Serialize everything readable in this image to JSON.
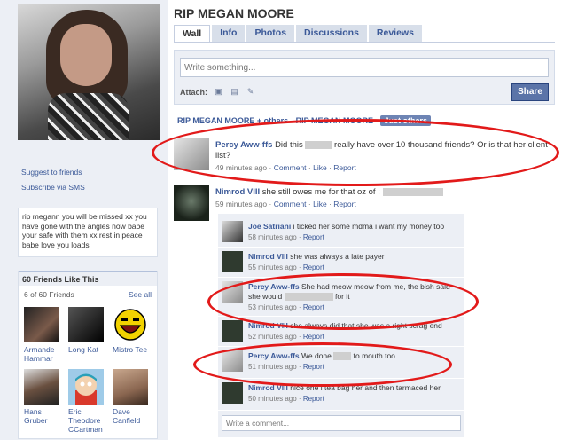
{
  "page": {
    "title": "RIP MEGAN MOORE"
  },
  "tabs": [
    "Wall",
    "Info",
    "Photos",
    "Discussions",
    "Reviews"
  ],
  "sidebar": {
    "links": [
      "Suggest to friends",
      "Subscribe via SMS"
    ],
    "bio": "rip megann you will be missed xx you have gone with the angles now babe your safe with them xx rest in peace babe love you loads",
    "friends_title": "60 Friends Like This",
    "friends_count": "6 of 60 Friends",
    "see_all": "See all",
    "friends": [
      {
        "name": "Armande Hammar"
      },
      {
        "name": "Long Kat"
      },
      {
        "name": "Mistro Tee"
      },
      {
        "name": "Hans Gruber"
      },
      {
        "name": "Eric Theodore CCartman"
      },
      {
        "name": "Dave Canfield"
      }
    ]
  },
  "composer": {
    "placeholder": "Write something...",
    "attach_label": "Attach:",
    "share_label": "Share"
  },
  "filters": [
    "RIP MEGAN MOORE + others",
    "RIP MEGAN MOORE",
    "Just others"
  ],
  "posts": [
    {
      "author": "Percy Aww-ffs",
      "text_a": "Did this",
      "text_b": "really have over 10 thousand friends? Or is that her client list?",
      "time": "49 minutes ago",
      "comment": "Comment",
      "like": "Like",
      "report": "Report"
    },
    {
      "author": "Nimrod VIII",
      "text_a": "she still owes me for that oz of :",
      "time": "59 minutes ago",
      "comment": "Comment",
      "like": "Like",
      "report": "Report"
    }
  ],
  "comments": [
    {
      "author": "Joe Satriani",
      "text": "i ticked her some mdma i want my money too",
      "time": "58 minutes ago",
      "report": "Report"
    },
    {
      "author": "Nimrod VIII",
      "text": "she was always a late payer",
      "time": "55 minutes ago",
      "report": "Report"
    },
    {
      "author": "Percy Aww-ffs",
      "text": "She had meow meow from me, the bish said she would",
      "text_b": "for it",
      "time": "53 minutes ago",
      "report": "Report"
    },
    {
      "author": "Nimrod VIII",
      "text": "she always did that she was a right scrag end",
      "time": "52 minutes ago",
      "report": "Report"
    },
    {
      "author": "Percy Aww-ffs",
      "text": "We done",
      "text_b": "to mouth too",
      "time": "51 minutes ago",
      "report": "Report"
    },
    {
      "author": "Nimrod VIII",
      "text": "nice one i tea bag her and then tarmaced her",
      "time": "50 minutes ago",
      "report": "Report"
    }
  ],
  "comment_box": {
    "placeholder": "Write a comment..."
  },
  "colors": {
    "link": "#3b5998",
    "highlight_ring": "#e21a1a",
    "share_button": "#5b74a8"
  }
}
